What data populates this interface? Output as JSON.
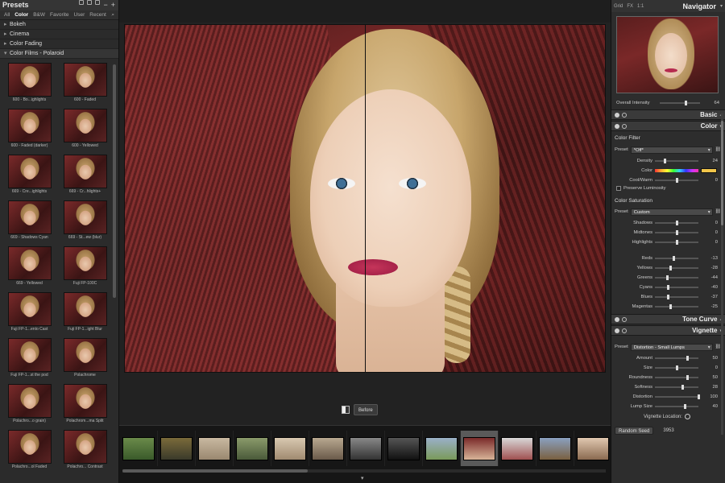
{
  "left_panel": {
    "title": "Presets",
    "tabs": [
      "All",
      "Color",
      "B&W",
      "Favorite",
      "User",
      "Recent"
    ],
    "active_tab": "Color",
    "categories": [
      {
        "label": "Bokeh",
        "open": false
      },
      {
        "label": "Cinema",
        "open": false
      },
      {
        "label": "Color Fading",
        "open": false
      },
      {
        "label": "Color Films - Polaroid",
        "open": true
      }
    ],
    "presets": [
      "600 - Bo...ighlights",
      "600 - Faded",
      "600 - Faded (darker)",
      "600 - Yellowed",
      "669 - Cre...ighlights",
      "669 - Cr...hlights+",
      "669 - Shadows Cyan",
      "669 - St...ew (blur)",
      "669 - Yellowed",
      "Fuji FP-100C",
      "Fuji FP-1...ento Cast",
      "Fuji FP-1...ight Blur",
      "Fuji FP-1...st the pod",
      "Polachrome",
      "Polachro...o grain)",
      "Polachrom...ma Split",
      "Polachro...ol Faded",
      "Polachro... Contrast"
    ]
  },
  "center": {
    "before_label": "Before",
    "filmstrip_count": 13,
    "selected_index": 9
  },
  "right_panel": {
    "top_tabs": [
      "Grid",
      "FX",
      "1:1"
    ],
    "navigator_title": "Navigator",
    "overall_intensity": {
      "label": "Overall Intensity",
      "value": "64",
      "level": 0.64
    },
    "sections": {
      "basic": "Basic",
      "color": "Color",
      "tone_curve": "Tone Curve",
      "vignette": "Vignette"
    },
    "color_filter": {
      "title": "Color Filter",
      "preset_label": "Preset",
      "preset_value": "*Off*",
      "density": {
        "label": "Density",
        "value": "24",
        "level": 0.24
      },
      "color_label": "Color",
      "cool_warm": {
        "label": "Cool/Warm",
        "value": "0",
        "level": 0.5
      },
      "preserve_label": "Preserve Luminosity"
    },
    "color_saturation": {
      "title": "Color Saturation",
      "preset_label": "Preset",
      "preset_value": "Custom",
      "sliders": [
        {
          "label": "Shadows",
          "value": "0",
          "level": 0.5
        },
        {
          "label": "Midtones",
          "value": "0",
          "level": 0.5
        },
        {
          "label": "Highlights",
          "value": "0",
          "level": 0.5
        },
        {
          "label": "Reds",
          "value": "-13",
          "level": 0.43
        },
        {
          "label": "Yellows",
          "value": "-28",
          "level": 0.36
        },
        {
          "label": "Greens",
          "value": "-44",
          "level": 0.28
        },
        {
          "label": "Cyans",
          "value": "-40",
          "level": 0.3
        },
        {
          "label": "Blues",
          "value": "-37",
          "level": 0.31
        },
        {
          "label": "Magentas",
          "value": "-25",
          "level": 0.37
        }
      ]
    },
    "vignette": {
      "preset_label": "Preset",
      "preset_value": "Distortion - Small Lumps",
      "sliders": [
        {
          "label": "Amount",
          "value": "50",
          "level": 0.75
        },
        {
          "label": "Size",
          "value": "0",
          "level": 0.5
        },
        {
          "label": "Roundness",
          "value": "50",
          "level": 0.75
        },
        {
          "label": "Softness",
          "value": "28",
          "level": 0.64
        },
        {
          "label": "Distortion",
          "value": "100",
          "level": 1.0
        },
        {
          "label": "Lump Size",
          "value": "40",
          "level": 0.7
        }
      ],
      "location_label": "Vignette Location:",
      "random_seed_label": "Random Seed",
      "random_seed_value": "3953"
    }
  }
}
